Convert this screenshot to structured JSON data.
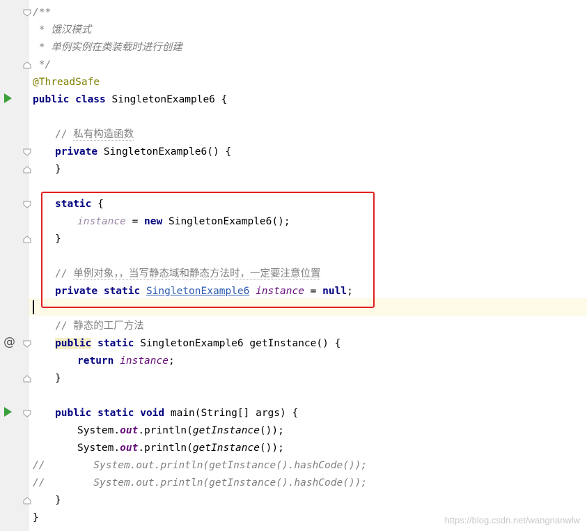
{
  "code": {
    "doc_open": "/**",
    "doc_line1_prefix": " * ",
    "doc_line1_text": "饿汉模式",
    "doc_line2_prefix": " * ",
    "doc_line2_text": "单例实例在类装载时进行创建",
    "doc_close": " */",
    "annotation": "@ThreadSafe",
    "class_kw": "public class",
    "class_name": " SingletonExample6 {",
    "comment_ctor_slashes": "// ",
    "comment_ctor_text": "私有构造函数",
    "ctor_kw": "private",
    "ctor_rest": " SingletonExample6() {",
    "close_brace": "}",
    "static_kw": "static",
    "static_rest": " {",
    "assign_field": "instance",
    "assign_eq": " = ",
    "assign_new": "new",
    "assign_rest": " SingletonExample6();",
    "comment_inst_slashes": "// ",
    "comment_inst_text": "单例对象，，当写静态域和静态方法时，一定要注意位置",
    "field_kw": "private static",
    "field_type": "SingletonExample6",
    "field_name": "instance",
    "field_eq": " = ",
    "field_null": "null",
    "field_semi": ";",
    "comment_factory_slashes": "// ",
    "comment_factory_text": "静态的工厂方法",
    "getinst_public": "public",
    "getinst_static": " static",
    "getinst_rest": " SingletonExample6 getInstance() {",
    "return_kw": "return",
    "return_field": "instance",
    "return_semi": ";",
    "main_kw": "public static void",
    "main_rest": " main(String[] args) {",
    "print_system": "System.",
    "print_out": "out",
    "print_mid": ".println(",
    "print_call": "getInstance",
    "print_end": "());",
    "commented_print": "//        System.out.println(getInstance().hashCode());",
    "class_close": "}"
  },
  "gutter": {
    "run_icon": "run-triangle-icon",
    "override_icon": "@",
    "fold_icon": "fold-marker-icon"
  },
  "highlight_box_color": "#e02020",
  "watermark": "https://blog.csdn.net/wangnanwlw"
}
